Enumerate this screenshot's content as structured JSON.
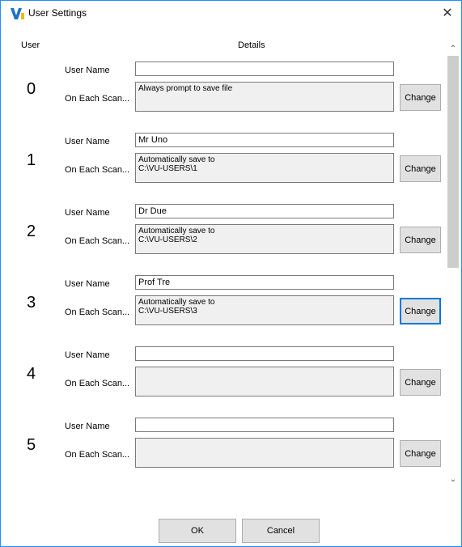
{
  "window": {
    "title": "User Settings",
    "close_glyph": "✕"
  },
  "headers": {
    "user": "User",
    "details": "Details"
  },
  "labels": {
    "user_name": "User Name",
    "on_each_scan": "On Each Scan..."
  },
  "rows": [
    {
      "number": "0",
      "name": "",
      "scan": "Always prompt to save file",
      "change": "Change"
    },
    {
      "number": "1",
      "name": "Mr Uno",
      "scan": "Automatically save to\nC:\\VU-USERS\\1",
      "change": "Change"
    },
    {
      "number": "2",
      "name": "Dr Due",
      "scan": "Automatically save to\nC:\\VU-USERS\\2",
      "change": "Change"
    },
    {
      "number": "3",
      "name": "Prof Tre",
      "scan": "Automatically save to\nC:\\VU-USERS\\3",
      "change": "Change"
    },
    {
      "number": "4",
      "name": "",
      "scan": "",
      "change": "Change"
    },
    {
      "number": "5",
      "name": "",
      "scan": "",
      "change": "Change"
    }
  ],
  "buttons": {
    "ok": "OK",
    "cancel": "Cancel"
  },
  "icons": {
    "app": "vu-logo-icon",
    "close": "close-icon",
    "scroll_up": "chevron-up-icon",
    "scroll_down": "chevron-down-icon"
  },
  "colors": {
    "logo_blue": "#1a73c8",
    "logo_yellow": "#f5b800",
    "focus": "#0078d7"
  }
}
